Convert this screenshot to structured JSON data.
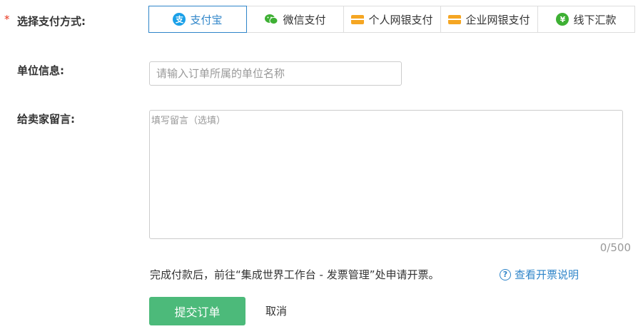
{
  "payment": {
    "required_mark": "*",
    "label": "选择支付方式:",
    "methods": [
      {
        "label": "支付宝",
        "icon": "alipay-icon",
        "glyph": "支",
        "active": true
      },
      {
        "label": "微信支付",
        "icon": "wechat-icon",
        "glyph": "",
        "active": false
      },
      {
        "label": "个人网银支付",
        "icon": "bank-card-icon",
        "glyph": "",
        "active": false
      },
      {
        "label": "企业网银支付",
        "icon": "bank-card-icon",
        "glyph": "",
        "active": false
      },
      {
        "label": "线下汇款",
        "icon": "yen-icon",
        "glyph": "¥",
        "active": false
      }
    ]
  },
  "company": {
    "label": "单位信息:",
    "placeholder": "请输入订单所属的单位名称",
    "value": ""
  },
  "message": {
    "label": "给卖家留言:",
    "placeholder": "填写留言（选填）",
    "value": "",
    "counter": "0/500"
  },
  "invoice": {
    "note": "完成付款后，前往“集成世界工作台 - 发票管理”处申请开票。",
    "link_icon": "?",
    "link_label": "查看开票说明"
  },
  "actions": {
    "submit_label": "提交订单",
    "cancel_label": "取消"
  },
  "colors": {
    "accent_blue": "#2f85c9",
    "submit_green": "#4cba7a",
    "required_red": "#e8341c",
    "card_orange": "#f5a623",
    "alipay_blue": "#1aa0e8",
    "wechat_green": "#3eb034"
  }
}
